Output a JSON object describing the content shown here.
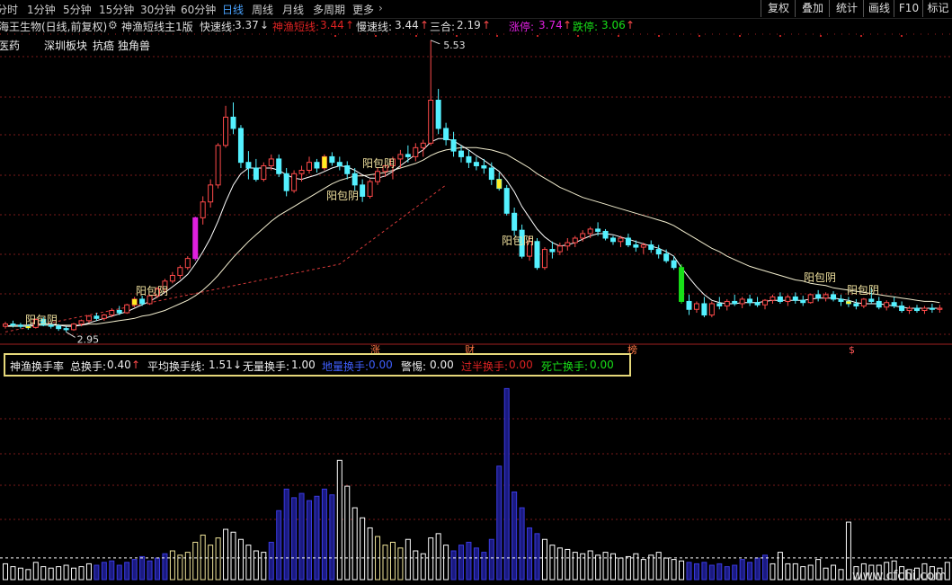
{
  "toolbar": {
    "periods": [
      "分时",
      "1分钟",
      "5分钟",
      "15分钟",
      "30分钟",
      "60分钟",
      "日线",
      "周线",
      "月线",
      "多周期",
      "更多"
    ],
    "more_arrow": "›",
    "active_period": "日线",
    "buttons": [
      "复权",
      "叠加",
      "统计",
      "画线",
      "F10",
      "标记"
    ]
  },
  "info": {
    "stock": "海王生物(日线,前复权)",
    "indicator": "神渔短线主1版",
    "fast_label": "快速线:",
    "fast_value": "3.37",
    "god_label": "神渔短线:",
    "god_value": "3.44",
    "slow_label": "慢速线:",
    "slow_value": "3.44",
    "sanhe_label": "三合:",
    "sanhe_value": "2.19",
    "zt_label": "涨停:",
    "zt_value": "3.74",
    "dt_label": "跌停:",
    "dt_value": "3.06"
  },
  "sectors": [
    "医药",
    "深圳板块",
    "抗癌",
    "独角兽"
  ],
  "annotations": {
    "high": "5.53",
    "low": "2.95",
    "pattern": "阳包阴",
    "event_marks": [
      "涨",
      "财",
      "榜",
      "$"
    ]
  },
  "indicator_panel": {
    "name": "神渔换手率",
    "total_label": "总换手:",
    "total_value": "0.40",
    "avg_label": "平均换手线:",
    "avg_value": "1.51",
    "none_label": "无量换手:",
    "none_value": "1.00",
    "low_label": "地量换手:",
    "low_value": "0.00",
    "warn_label": "警惕:",
    "warn_value": "0.00",
    "over_label": "过半换手:",
    "over_value": "0.00",
    "death_label": "死亡换手:",
    "death_value": "0.00"
  },
  "watermark": "www.cfchi.com",
  "colors": {
    "up": "#ff4a4a",
    "down": "#54f1ff",
    "limit_up": "#e020e0",
    "limit_down": "#18e018",
    "yellow": "#ffee22",
    "vol_pale": "#f0e59a",
    "vol_blue": "#3a3adf",
    "vol_white": "#ffffff",
    "blue_text": "#3f5fff",
    "grid": "#7a1a1a"
  },
  "chart_data": {
    "type": "candlestick",
    "ohlc": [
      [
        3.0,
        3.04,
        2.98,
        3.02
      ],
      [
        3.02,
        3.05,
        2.99,
        3.01
      ],
      [
        3.01,
        3.03,
        2.98,
        3.0
      ],
      [
        3.0,
        3.02,
        2.97,
        2.99
      ],
      [
        2.99,
        3.07,
        2.98,
        3.06
      ],
      [
        3.06,
        3.08,
        3.0,
        3.01
      ],
      [
        3.01,
        3.03,
        2.98,
        3.0
      ],
      [
        3.0,
        3.02,
        2.96,
        2.98
      ],
      [
        2.98,
        3.0,
        2.95,
        2.97
      ],
      [
        2.97,
        3.03,
        2.96,
        3.02
      ],
      [
        3.02,
        3.06,
        3.0,
        3.05
      ],
      [
        3.05,
        3.1,
        3.03,
        3.09
      ],
      [
        3.09,
        3.12,
        3.05,
        3.07
      ],
      [
        3.07,
        3.11,
        3.05,
        3.1
      ],
      [
        3.1,
        3.16,
        3.08,
        3.14
      ],
      [
        3.14,
        3.18,
        3.1,
        3.12
      ],
      [
        3.12,
        3.2,
        3.11,
        3.19
      ],
      [
        3.19,
        3.26,
        3.17,
        3.24
      ],
      [
        3.24,
        3.27,
        3.18,
        3.2
      ],
      [
        3.2,
        3.28,
        3.19,
        3.27
      ],
      [
        3.27,
        3.35,
        3.25,
        3.33
      ],
      [
        3.33,
        3.42,
        3.3,
        3.4
      ],
      [
        3.4,
        3.48,
        3.38,
        3.45
      ],
      [
        3.45,
        3.54,
        3.42,
        3.52
      ],
      [
        3.52,
        3.62,
        3.5,
        3.6
      ],
      [
        3.6,
        3.97,
        3.58,
        3.96
      ],
      [
        3.96,
        4.15,
        3.9,
        4.1
      ],
      [
        4.1,
        4.3,
        4.05,
        4.25
      ],
      [
        4.25,
        4.62,
        4.22,
        4.6
      ],
      [
        4.6,
        4.95,
        4.58,
        4.85
      ],
      [
        4.85,
        4.98,
        4.7,
        4.75
      ],
      [
        4.75,
        4.78,
        4.4,
        4.45
      ],
      [
        4.45,
        4.55,
        4.3,
        4.4
      ],
      [
        4.4,
        4.48,
        4.28,
        4.3
      ],
      [
        4.3,
        4.45,
        4.28,
        4.42
      ],
      [
        4.42,
        4.52,
        4.38,
        4.48
      ],
      [
        4.48,
        4.52,
        4.32,
        4.35
      ],
      [
        4.35,
        4.4,
        4.15,
        4.2
      ],
      [
        4.2,
        4.38,
        4.18,
        4.35
      ],
      [
        4.35,
        4.42,
        4.28,
        4.38
      ],
      [
        4.38,
        4.5,
        4.35,
        4.45
      ],
      [
        4.45,
        4.48,
        4.36,
        4.4
      ],
      [
        4.4,
        4.52,
        4.38,
        4.5
      ],
      [
        4.5,
        4.54,
        4.42,
        4.45
      ],
      [
        4.45,
        4.5,
        4.38,
        4.42
      ],
      [
        4.42,
        4.46,
        4.3,
        4.35
      ],
      [
        4.35,
        4.4,
        4.2,
        4.25
      ],
      [
        4.25,
        4.3,
        4.1,
        4.15
      ],
      [
        4.15,
        4.3,
        4.13,
        4.28
      ],
      [
        4.28,
        4.4,
        4.25,
        4.37
      ],
      [
        4.37,
        4.45,
        4.32,
        4.42
      ],
      [
        4.42,
        4.5,
        4.3,
        4.48
      ],
      [
        4.48,
        4.56,
        4.4,
        4.52
      ],
      [
        4.52,
        4.6,
        4.45,
        4.5
      ],
      [
        4.5,
        4.62,
        4.46,
        4.58
      ],
      [
        4.58,
        4.65,
        4.5,
        4.62
      ],
      [
        4.62,
        5.53,
        4.6,
        5.0
      ],
      [
        5.0,
        5.1,
        4.7,
        4.75
      ],
      [
        4.75,
        4.8,
        4.6,
        4.65
      ],
      [
        4.65,
        4.72,
        4.5,
        4.55
      ],
      [
        4.55,
        4.6,
        4.45,
        4.5
      ],
      [
        4.5,
        4.56,
        4.4,
        4.45
      ],
      [
        4.45,
        4.5,
        4.38,
        4.42
      ],
      [
        4.42,
        4.48,
        4.35,
        4.4
      ],
      [
        4.4,
        4.45,
        4.25,
        4.3
      ],
      [
        4.3,
        4.36,
        4.2,
        4.22
      ],
      [
        4.22,
        4.25,
        3.98,
        4.0
      ],
      [
        4.0,
        4.05,
        3.8,
        3.85
      ],
      [
        3.85,
        3.9,
        3.6,
        3.62
      ],
      [
        3.62,
        3.8,
        3.58,
        3.75
      ],
      [
        3.75,
        3.78,
        3.5,
        3.52
      ],
      [
        3.52,
        3.7,
        3.5,
        3.68
      ],
      [
        3.68,
        3.75,
        3.6,
        3.66
      ],
      [
        3.66,
        3.74,
        3.63,
        3.71
      ],
      [
        3.71,
        3.78,
        3.67,
        3.74
      ],
      [
        3.74,
        3.8,
        3.7,
        3.78
      ],
      [
        3.78,
        3.85,
        3.75,
        3.82
      ],
      [
        3.82,
        3.88,
        3.78,
        3.86
      ],
      [
        3.86,
        3.92,
        3.8,
        3.84
      ],
      [
        3.84,
        3.86,
        3.76,
        3.78
      ],
      [
        3.78,
        3.8,
        3.72,
        3.75
      ],
      [
        3.75,
        3.8,
        3.7,
        3.78
      ],
      [
        3.78,
        3.82,
        3.7,
        3.72
      ],
      [
        3.72,
        3.76,
        3.66,
        3.7
      ],
      [
        3.7,
        3.74,
        3.64,
        3.72
      ],
      [
        3.72,
        3.76,
        3.65,
        3.68
      ],
      [
        3.68,
        3.72,
        3.6,
        3.64
      ],
      [
        3.64,
        3.68,
        3.56,
        3.58
      ],
      [
        3.58,
        3.62,
        3.5,
        3.52
      ],
      [
        3.52,
        3.55,
        3.2,
        3.22
      ],
      [
        3.22,
        3.28,
        3.1,
        3.15
      ],
      [
        3.15,
        3.22,
        3.12,
        3.2
      ],
      [
        3.2,
        3.26,
        3.08,
        3.1
      ],
      [
        3.1,
        3.22,
        3.08,
        3.2
      ],
      [
        3.2,
        3.26,
        3.15,
        3.18
      ],
      [
        3.18,
        3.24,
        3.14,
        3.22
      ],
      [
        3.22,
        3.28,
        3.18,
        3.2
      ],
      [
        3.2,
        3.26,
        3.16,
        3.24
      ],
      [
        3.24,
        3.28,
        3.18,
        3.21
      ],
      [
        3.21,
        3.26,
        3.17,
        3.19
      ],
      [
        3.19,
        3.24,
        3.15,
        3.23
      ],
      [
        3.23,
        3.28,
        3.2,
        3.26
      ],
      [
        3.26,
        3.3,
        3.2,
        3.22
      ],
      [
        3.22,
        3.28,
        3.18,
        3.26
      ],
      [
        3.26,
        3.3,
        3.2,
        3.23
      ],
      [
        3.23,
        3.27,
        3.18,
        3.21
      ],
      [
        3.21,
        3.29,
        3.2,
        3.28
      ],
      [
        3.28,
        3.32,
        3.22,
        3.25
      ],
      [
        3.25,
        3.3,
        3.22,
        3.28
      ],
      [
        3.28,
        3.31,
        3.22,
        3.24
      ],
      [
        3.24,
        3.28,
        3.18,
        3.22
      ],
      [
        3.22,
        3.26,
        3.17,
        3.2
      ],
      [
        3.2,
        3.24,
        3.15,
        3.18
      ],
      [
        3.18,
        3.25,
        3.16,
        3.24
      ],
      [
        3.24,
        3.34,
        3.2,
        3.22
      ],
      [
        3.22,
        3.26,
        3.15,
        3.17
      ],
      [
        3.17,
        3.23,
        3.14,
        3.21
      ],
      [
        3.21,
        3.26,
        3.16,
        3.18
      ],
      [
        3.18,
        3.22,
        3.12,
        3.14
      ],
      [
        3.14,
        3.18,
        3.11,
        3.16
      ],
      [
        3.16,
        3.19,
        3.12,
        3.14
      ],
      [
        3.14,
        3.18,
        3.11,
        3.16
      ],
      [
        3.16,
        3.2,
        3.12,
        3.15
      ],
      [
        3.15,
        3.19,
        3.12,
        3.16
      ]
    ],
    "ma_fast": [
      3.0,
      3.01,
      3.01,
      3.01,
      3.02,
      3.02,
      3.02,
      3.01,
      3.0,
      3.0,
      3.01,
      3.03,
      3.05,
      3.07,
      3.09,
      3.11,
      3.13,
      3.16,
      3.19,
      3.22,
      3.26,
      3.3,
      3.35,
      3.4,
      3.46,
      3.55,
      3.66,
      3.78,
      3.93,
      4.1,
      4.25,
      4.35,
      4.4,
      4.4,
      4.4,
      4.4,
      4.38,
      4.34,
      4.31,
      4.3,
      4.32,
      4.34,
      4.37,
      4.4,
      4.42,
      4.41,
      4.38,
      4.34,
      4.31,
      4.31,
      4.33,
      4.37,
      4.42,
      4.47,
      4.52,
      4.56,
      4.63,
      4.66,
      4.66,
      4.64,
      4.6,
      4.56,
      4.51,
      4.47,
      4.42,
      4.37,
      4.29,
      4.19,
      4.06,
      3.96,
      3.86,
      3.79,
      3.74,
      3.71,
      3.72,
      3.74,
      3.77,
      3.8,
      3.82,
      3.82,
      3.81,
      3.79,
      3.77,
      3.75,
      3.73,
      3.71,
      3.69,
      3.66,
      3.62,
      3.52,
      3.43,
      3.35,
      3.28,
      3.23,
      3.21,
      3.2,
      3.2,
      3.21,
      3.21,
      3.21,
      3.22,
      3.23,
      3.23,
      3.23,
      3.23,
      3.23,
      3.24,
      3.25,
      3.25,
      3.25,
      3.24,
      3.23,
      3.21,
      3.2,
      3.2,
      3.2,
      3.19,
      3.18,
      3.17,
      3.16,
      3.16,
      3.16,
      3.16,
      3.16
    ],
    "ma_slow": [
      3.0,
      3.0,
      3.0,
      3.0,
      3.01,
      3.01,
      3.01,
      3.01,
      3.01,
      3.01,
      3.01,
      3.02,
      3.02,
      3.03,
      3.04,
      3.05,
      3.06,
      3.07,
      3.09,
      3.1,
      3.12,
      3.14,
      3.17,
      3.2,
      3.23,
      3.27,
      3.32,
      3.38,
      3.45,
      3.53,
      3.61,
      3.68,
      3.75,
      3.81,
      3.87,
      3.93,
      3.98,
      4.02,
      4.06,
      4.1,
      4.14,
      4.18,
      4.22,
      4.26,
      4.29,
      4.31,
      4.33,
      4.33,
      4.34,
      4.35,
      4.36,
      4.38,
      4.4,
      4.42,
      4.44,
      4.47,
      4.51,
      4.54,
      4.56,
      4.57,
      4.58,
      4.58,
      4.58,
      4.57,
      4.56,
      4.54,
      4.52,
      4.48,
      4.44,
      4.4,
      4.35,
      4.31,
      4.27,
      4.23,
      4.2,
      4.17,
      4.14,
      4.12,
      4.1,
      4.08,
      4.06,
      4.04,
      4.02,
      4.0,
      3.98,
      3.96,
      3.94,
      3.92,
      3.89,
      3.85,
      3.81,
      3.77,
      3.73,
      3.69,
      3.66,
      3.62,
      3.59,
      3.56,
      3.53,
      3.51,
      3.49,
      3.47,
      3.45,
      3.43,
      3.41,
      3.4,
      3.38,
      3.37,
      3.36,
      3.34,
      3.33,
      3.32,
      3.31,
      3.3,
      3.29,
      3.28,
      3.27,
      3.26,
      3.25,
      3.24,
      3.23,
      3.22,
      3.22,
      3.21
    ],
    "turnover": [
      1.1,
      0.9,
      0.8,
      0.7,
      1.2,
      0.9,
      0.8,
      0.9,
      1.0,
      0.8,
      0.9,
      1.1,
      1.0,
      1.2,
      1.3,
      1.0,
      1.2,
      1.4,
      1.6,
      1.3,
      1.5,
      1.8,
      2.0,
      1.7,
      1.9,
      2.6,
      3.1,
      2.4,
      2.9,
      3.5,
      3.3,
      2.8,
      2.4,
      2.0,
      1.9,
      2.6,
      4.8,
      6.3,
      5.7,
      6.0,
      5.5,
      5.8,
      6.3,
      5.9,
      8.3,
      6.5,
      5.0,
      4.3,
      3.6,
      3.0,
      2.4,
      2.6,
      2.2,
      2.8,
      2.0,
      1.8,
      2.9,
      3.2,
      2.4,
      2.0,
      2.4,
      2.6,
      2.2,
      1.9,
      2.8,
      7.9,
      13.3,
      6.1,
      5.0,
      3.6,
      3.2,
      2.8,
      2.4,
      2.2,
      2.1,
      1.9,
      1.8,
      2.0,
      1.7,
      1.9,
      1.8,
      1.5,
      1.6,
      1.8,
      1.4,
      1.7,
      1.9,
      1.5,
      1.4,
      1.3,
      1.2,
      1.1,
      1.2,
      1.0,
      1.1,
      0.9,
      1.0,
      1.4,
      1.2,
      1.5,
      1.7,
      1.1,
      1.9,
      1.1,
      1.1,
      0.9,
      1.0,
      1.4,
      0.8,
      1.0,
      0.7,
      4.0,
      0.9,
      1.1,
      1.0,
      1.0,
      1.2,
      1.3,
      0.9,
      0.7,
      0.8,
      1.1,
      0.9,
      0.8,
      1.2,
      1.0
    ],
    "ylim": [
      2.85,
      5.6
    ],
    "avg_turnover_line": 1.51
  }
}
